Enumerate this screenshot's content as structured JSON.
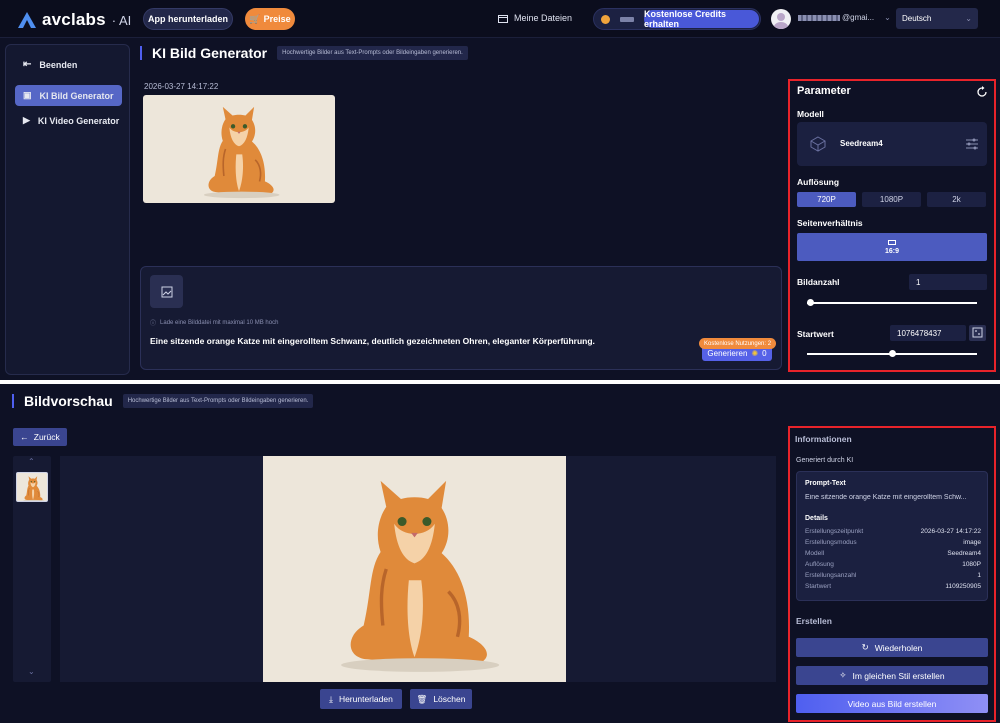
{
  "header": {
    "logo_text": "avclabs",
    "logo_ai": "· AI",
    "app_download": "App herunterladen",
    "prices": "Preise",
    "my_files": "Meine Dateien",
    "free_credits": "Kostenlose Credits erhalten",
    "email_suffix": "@gmai...",
    "language": "Deutsch"
  },
  "sidebar": {
    "items": [
      {
        "label": "Beenden",
        "icon": "exit-icon"
      },
      {
        "label": "KI Bild Generator",
        "icon": "image-generator-icon"
      },
      {
        "label": "KI Video Generator",
        "icon": "video-generator-icon"
      }
    ]
  },
  "generator": {
    "title": "KI Bild Generator",
    "subtitle": "Hochwertige Bilder aus Text-Prompts oder Bildeingaben generieren.",
    "timestamp": "2026-03-27 14:17:22",
    "upload_hint": "Lade eine Bilddatei mit maximal 10 MB hoch",
    "prompt": "Eine sitzende orange Katze mit eingerolltem Schwanz, deutlich gezeichneten Ohren, eleganter Körperführung.",
    "free_uses": "Kostenlose Nutzungen: 2",
    "generate_label": "Generieren",
    "generate_cost": "0"
  },
  "parameters": {
    "title": "Parameter",
    "model_label": "Modell",
    "model_name": "Seedream4",
    "resolution_label": "Auflösung",
    "resolutions": [
      "720P",
      "1080P",
      "2k"
    ],
    "resolution_selected": "720P",
    "aspect_label": "Seitenverhältnis",
    "aspect_value": "16:9",
    "count_label": "Bildanzahl",
    "count_value": "1",
    "count_slider_fraction": 0,
    "seed_label": "Startwert",
    "seed_value": "1076478437",
    "seed_slider_fraction": 0.5
  },
  "preview": {
    "title": "Bildvorschau",
    "subtitle": "Hochwertige Bilder aus Text-Prompts oder Bildeingaben generieren.",
    "back": "Zurück",
    "download": "Herunterladen",
    "delete": "Löschen"
  },
  "info": {
    "title": "Informationen",
    "generated_by": "Generiert durch KI",
    "prompt_heading": "Prompt-Text",
    "prompt_text": "Eine sitzende orange Katze mit eingerolltem Schw...",
    "details_heading": "Details",
    "details": [
      {
        "k": "Erstellungszeitpunkt",
        "v": "2026-03-27 14:17:22"
      },
      {
        "k": "Erstellungsmodus",
        "v": "image"
      },
      {
        "k": "Modell",
        "v": "Seedream4"
      },
      {
        "k": "Auflösung",
        "v": "1080P"
      },
      {
        "k": "Erstellungsanzahl",
        "v": "1"
      },
      {
        "k": "Startwert",
        "v": "1109250905"
      }
    ],
    "create_heading": "Erstellen",
    "repeat": "Wiederholen",
    "same_style": "Im gleichen Stil erstellen",
    "video_from_image": "Video aus Bild erstellen"
  },
  "colors": {
    "accent": "#4f5ff0",
    "highlight_border": "#e8232a",
    "price_orange": "#f08a3c"
  }
}
